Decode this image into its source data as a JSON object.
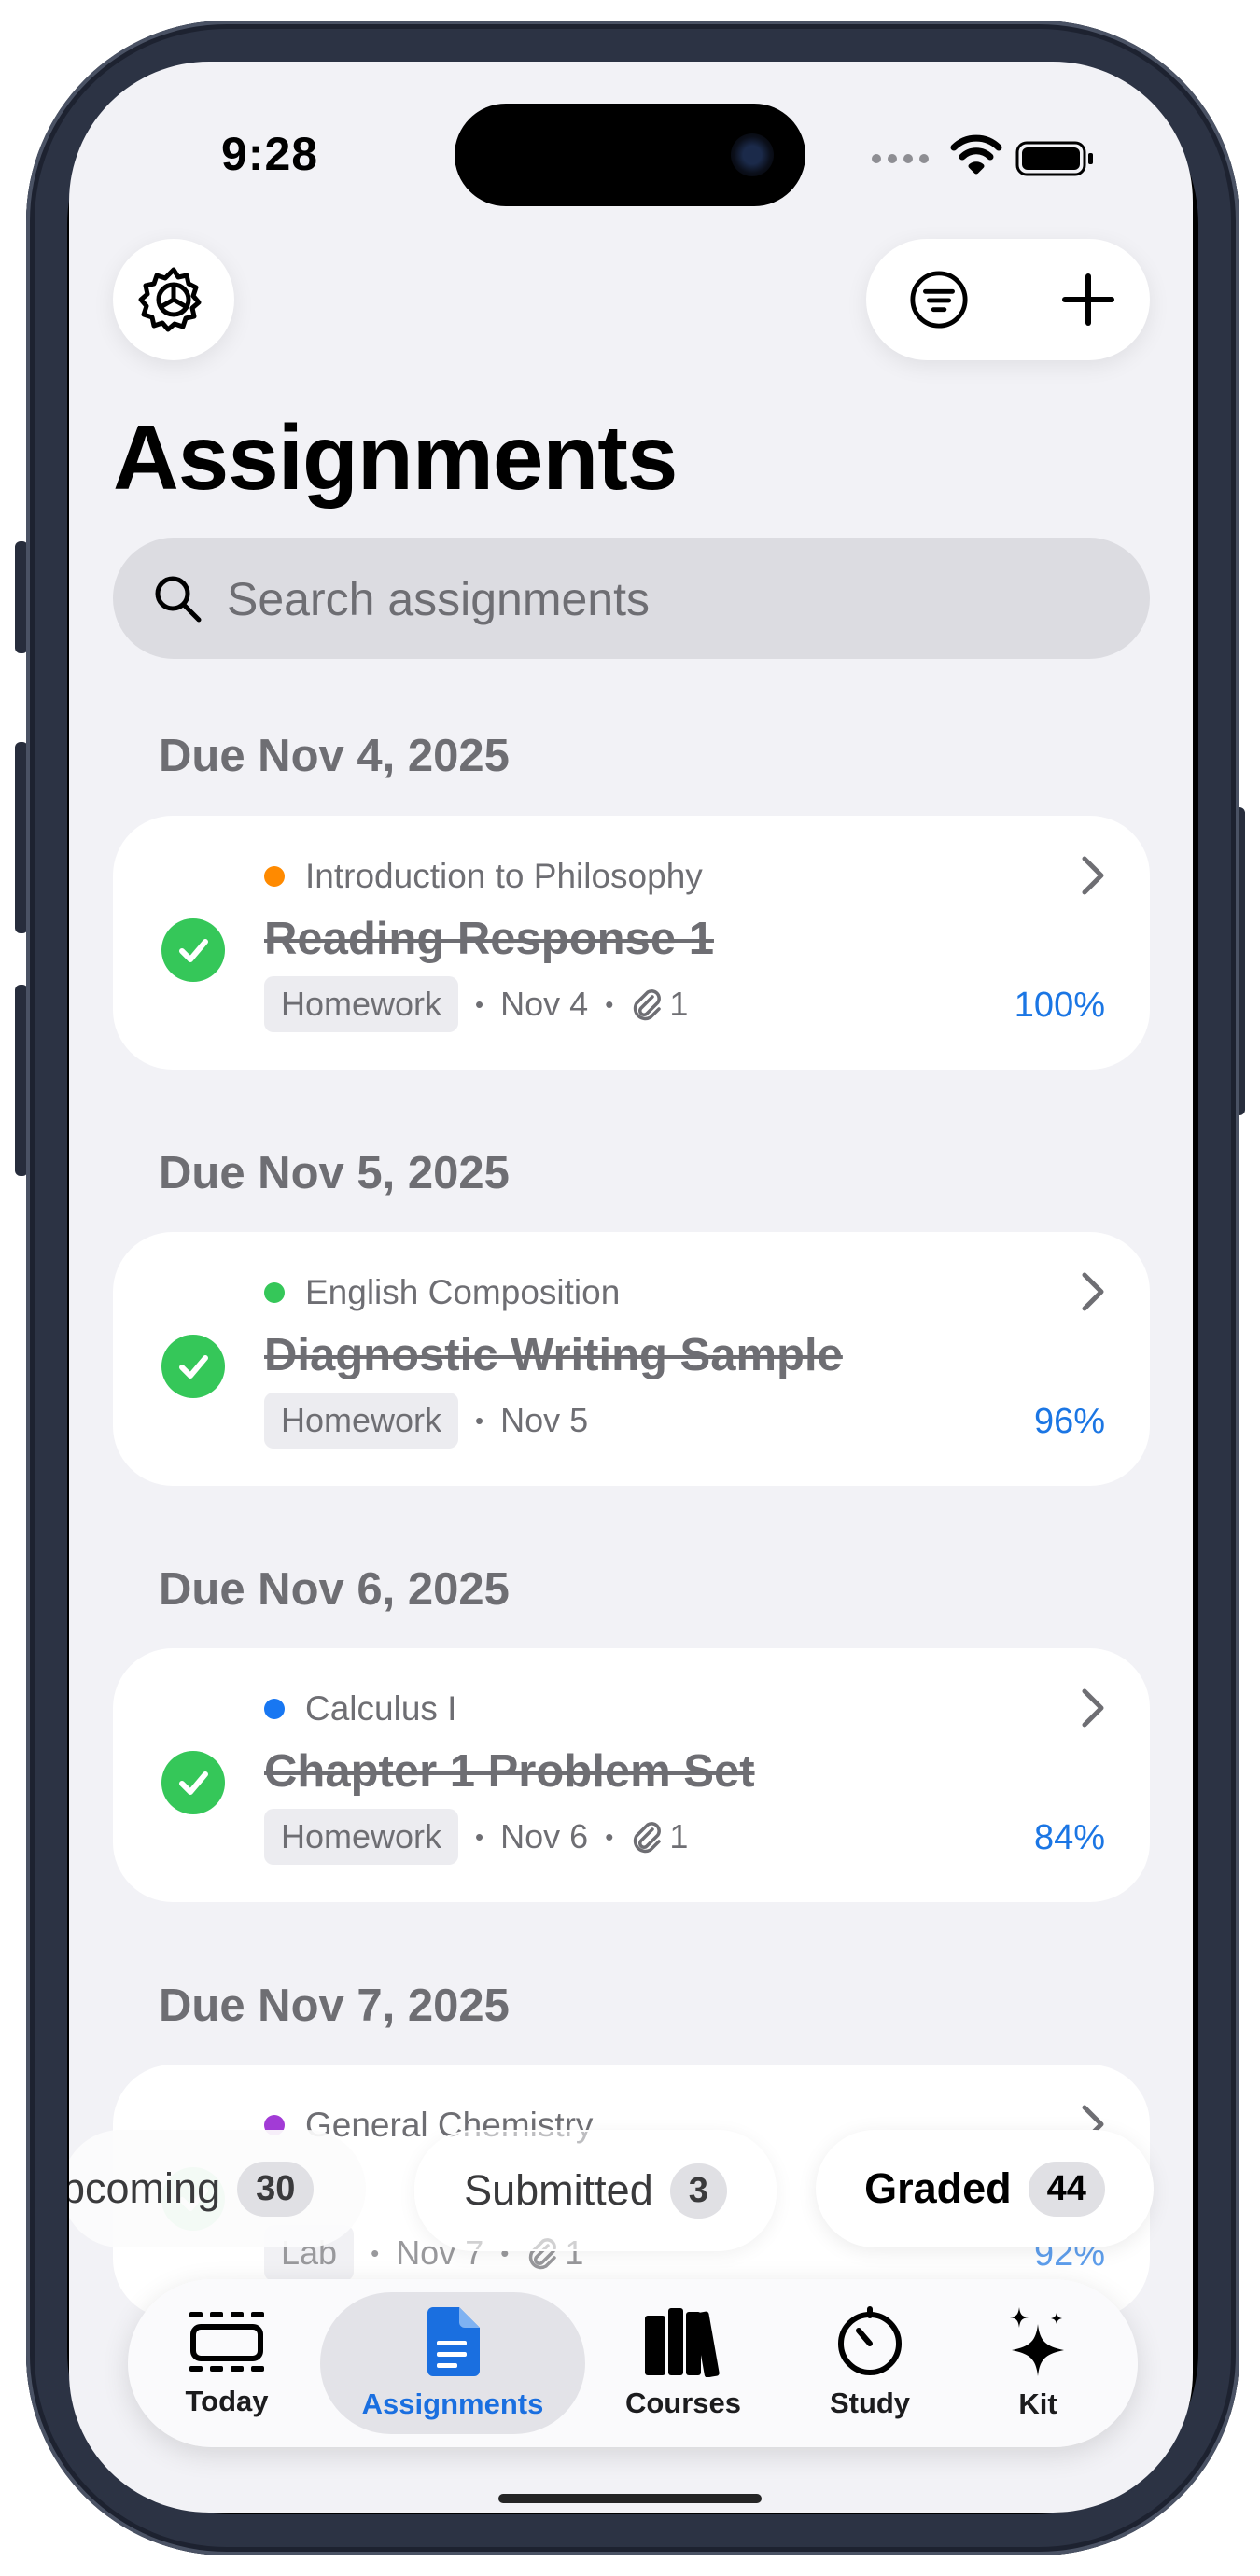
{
  "status_bar": {
    "time": "9:28"
  },
  "header": {
    "title": "Assignments"
  },
  "search": {
    "placeholder": "Search assignments"
  },
  "sections": [
    {
      "header": "Due Nov 4, 2025",
      "course": "Introduction to Philosophy",
      "course_color": "#ff8a00",
      "title": "Reading Response 1",
      "tag": "Homework",
      "date": "Nov 4",
      "attachments": "1",
      "grade": "100%"
    },
    {
      "header": "Due Nov 5, 2025",
      "course": "English Composition",
      "course_color": "#35c759",
      "title": "Diagnostic Writing Sample",
      "tag": "Homework",
      "date": "Nov 5",
      "attachments": "",
      "grade": "96%"
    },
    {
      "header": "Due Nov 6, 2025",
      "course": "Calculus I",
      "course_color": "#1877f2",
      "title": "Chapter 1 Problem Set",
      "tag": "Homework",
      "date": "Nov 6",
      "attachments": "1",
      "grade": "84%"
    },
    {
      "header": "Due Nov 7, 2025",
      "course": "General Chemistry",
      "course_color": "#a23bd6",
      "title": "",
      "tag": "Lab",
      "date": "Nov 7",
      "attachments": "1",
      "grade": "92%"
    }
  ],
  "filters": [
    {
      "label": "pcoming",
      "count": "30"
    },
    {
      "label": "Submitted",
      "count": "3"
    },
    {
      "label": "Graded",
      "count": "44",
      "selected": true
    }
  ],
  "tabs": [
    {
      "label": "Today",
      "icon": "today-icon"
    },
    {
      "label": "Assignments",
      "icon": "document-icon",
      "active": true
    },
    {
      "label": "Courses",
      "icon": "books-icon"
    },
    {
      "label": "Study",
      "icon": "timer-icon"
    },
    {
      "label": "Kit",
      "icon": "sparkles-icon"
    }
  ],
  "colors": {
    "accent": "#1a6fe0",
    "check": "#35c759",
    "grade": "#1b76e4"
  }
}
